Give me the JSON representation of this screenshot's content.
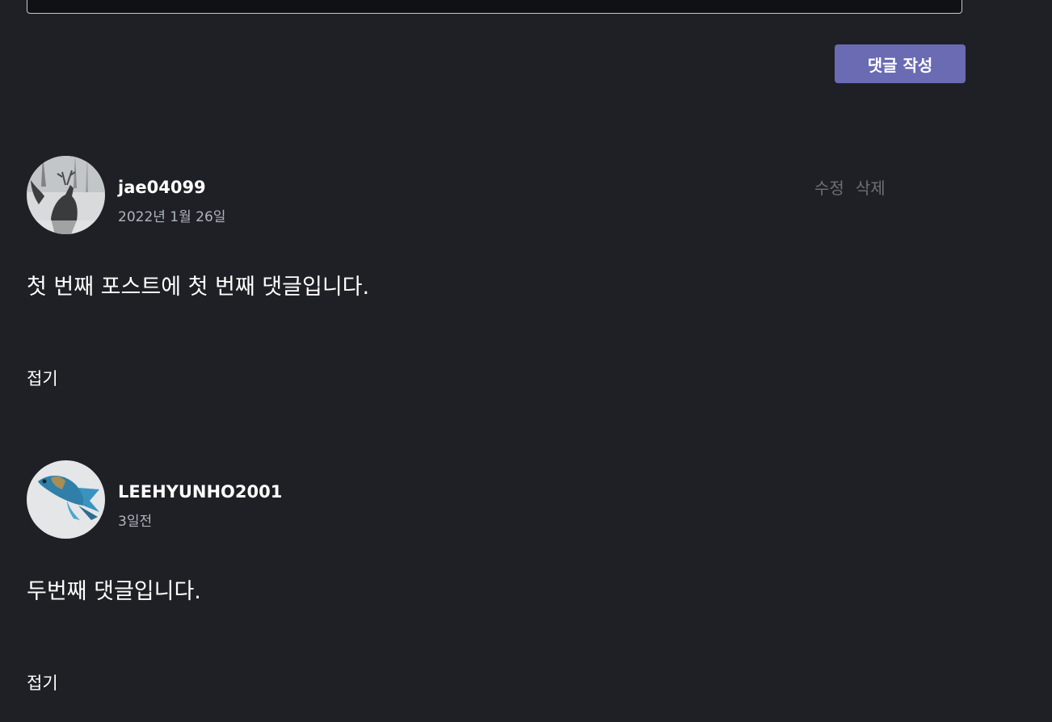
{
  "editor": {
    "submit_label": "댓글 작성"
  },
  "comments": [
    {
      "author": "jae04099",
      "date": "2022년 1월 26일",
      "body": "첫 번째 포스트에 첫 번째 댓글입니다.",
      "edit_label": "수정",
      "delete_label": "삭제",
      "fold_label": "접기"
    },
    {
      "author": "LEEHYUNHO2001",
      "date": "3일전",
      "body": "두번째 댓글입니다.",
      "fold_label": "접기"
    }
  ],
  "colors": {
    "background": "#1f2025",
    "accent": "#6a6bb3",
    "muted_text": "#adb5bd",
    "action_text": "#6c7075"
  }
}
